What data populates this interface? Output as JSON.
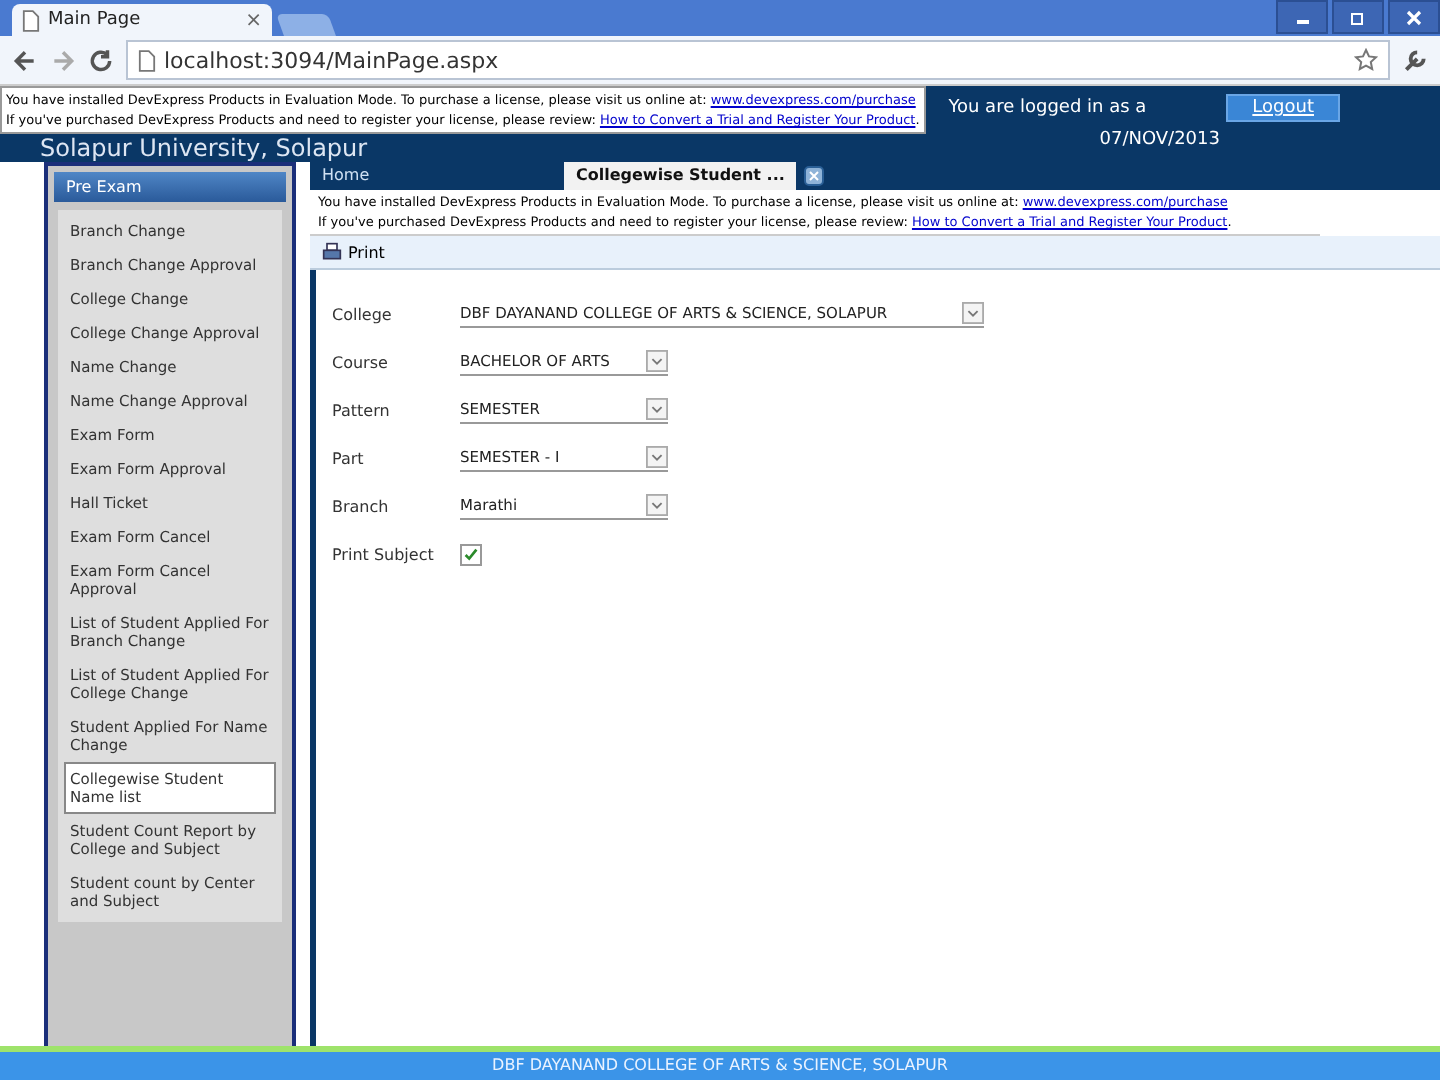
{
  "browser": {
    "tab_title": "Main Page",
    "tab_close": "×",
    "address": "localhost:3094/MainPage.aspx"
  },
  "header": {
    "notice": [
      "You have installed DevExpress Products in Evaluation Mode.  To purchase a license, please visit us online at: ",
      "www.devexpress.com/purchase",
      "If you've purchased DevExpress Products and need to register your license, please review: ",
      "How to Convert a Trial and Register Your Product",
      "."
    ],
    "title": "Solapur University, Solapur",
    "login_text": "You are logged in as a",
    "logout": "Logout",
    "date": "07/NOV/2013"
  },
  "sidebar": {
    "group": "Pre Exam",
    "items": [
      {
        "label": "Branch Change",
        "selected": false
      },
      {
        "label": "Branch Change Approval",
        "selected": false
      },
      {
        "label": "College Change",
        "selected": false
      },
      {
        "label": "College Change Approval",
        "selected": false
      },
      {
        "label": "Name Change",
        "selected": false
      },
      {
        "label": "Name Change Approval",
        "selected": false
      },
      {
        "label": "Exam Form",
        "selected": false
      },
      {
        "label": "Exam Form Approval",
        "selected": false
      },
      {
        "label": "Hall Ticket",
        "selected": false
      },
      {
        "label": "Exam Form Cancel",
        "selected": false
      },
      {
        "label": "Exam Form Cancel Approval",
        "selected": false
      },
      {
        "label": "List of Student Applied For Branch Change",
        "selected": false
      },
      {
        "label": "List of Student Applied For College Change",
        "selected": false
      },
      {
        "label": "Student Applied For Name Change",
        "selected": false
      },
      {
        "label": "Collegewise Student Name list",
        "selected": true
      },
      {
        "label": "Student Count Report by College and Subject",
        "selected": false
      },
      {
        "label": "Student count by Center and Subject",
        "selected": false
      }
    ]
  },
  "tabs": [
    {
      "label": "Home",
      "selected": false
    },
    {
      "label": "Collegewise Student ...",
      "selected": true
    }
  ],
  "notice": [
    "You have installed DevExpress Products in Evaluation Mode.  To purchase a license, please visit us online at: ",
    "www.devexpress.com/purchase",
    "If you've purchased DevExpress Products and need to register your license, please review: ",
    "How to Convert a Trial and Register Your Product",
    "."
  ],
  "toolbar": {
    "print": "Print"
  },
  "form": {
    "fields": [
      {
        "label": "College",
        "value": "DBF DAYANAND COLLEGE OF ARTS & SCIENCE, SOLAPUR",
        "kind": "wide"
      },
      {
        "label": "Course",
        "value": "BACHELOR OF ARTS",
        "kind": "select"
      },
      {
        "label": "Pattern",
        "value": "SEMESTER",
        "kind": "select"
      },
      {
        "label": "Part",
        "value": "SEMESTER - I",
        "kind": "select"
      },
      {
        "label": "Branch",
        "value": "Marathi",
        "kind": "select"
      }
    ],
    "print_subject": {
      "label": "Print Subject",
      "checked": true
    }
  },
  "footer": "DBF DAYANAND COLLEGE OF ARTS & SCIENCE, SOLAPUR"
}
